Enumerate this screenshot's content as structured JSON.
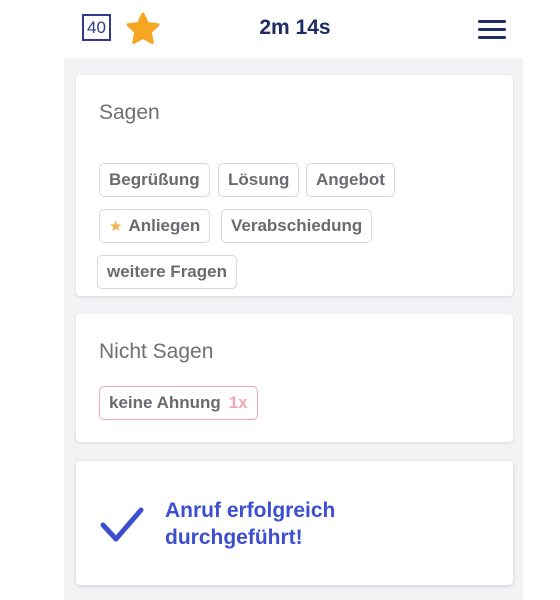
{
  "header": {
    "level": "40",
    "timer": "2m 14s"
  },
  "say_section": {
    "title": "Sagen",
    "chips": [
      {
        "label": "Begrüßung"
      },
      {
        "label": "Lösung"
      },
      {
        "label": "Angebot"
      },
      {
        "label": "Anliegen",
        "starred": true
      },
      {
        "label": "Verabschiedung"
      },
      {
        "label": "weitere Fragen"
      }
    ]
  },
  "dont_say_section": {
    "title": "Nicht Sagen",
    "chips": [
      {
        "label": "keine Ahnung",
        "count": "1x"
      }
    ]
  },
  "result": {
    "message": "Anruf erfolgreich durchgeführt!"
  },
  "colors": {
    "accent": "#3d4fd1",
    "navy": "#1f2b63",
    "star": "#f5a623",
    "negative": "#f0a8b0"
  }
}
